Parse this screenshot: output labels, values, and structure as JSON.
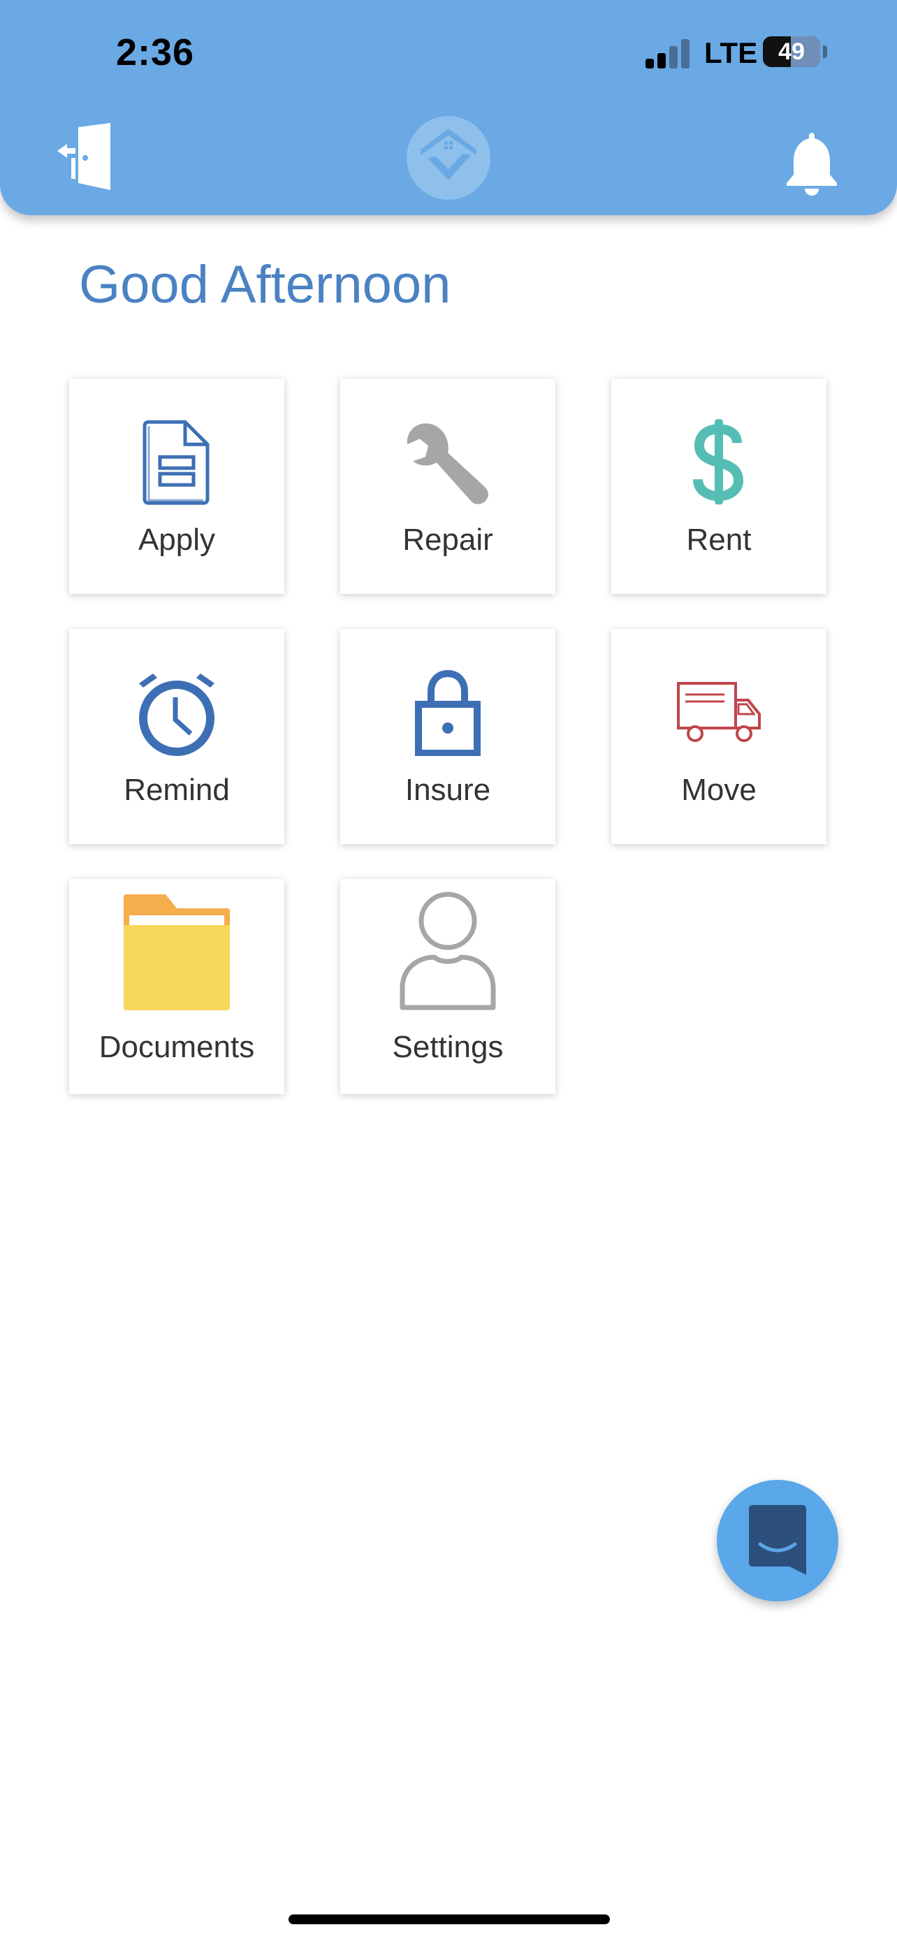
{
  "status_bar": {
    "time": "2:36",
    "network": "LTE",
    "battery_percent": "49",
    "battery_level": 0.49
  },
  "header": {
    "background_color": "#6aa9e4",
    "left_icon": "logout-door-icon",
    "center_icon": "home-logo-icon",
    "right_icon": "bell-icon"
  },
  "greeting": "Good Afternoon",
  "tiles": [
    {
      "label": "Apply",
      "icon": "document-icon",
      "color": "#3d6fb4"
    },
    {
      "label": "Repair",
      "icon": "wrench-icon",
      "color": "#a6a6a6"
    },
    {
      "label": "Rent",
      "icon": "dollar-icon",
      "color": "#56bdb4"
    },
    {
      "label": "Remind",
      "icon": "alarm-clock-icon",
      "color": "#3d6fb4"
    },
    {
      "label": "Insure",
      "icon": "lock-icon",
      "color": "#3d6fb4"
    },
    {
      "label": "Move",
      "icon": "truck-icon",
      "color": "#c0464c"
    },
    {
      "label": "Documents",
      "icon": "folder-icon",
      "color": "#f7d759"
    },
    {
      "label": "Settings",
      "icon": "user-icon",
      "color": "#a6a6a6"
    }
  ],
  "chat": {
    "icon": "chat-bubble-icon",
    "color": "#5aa7e9"
  }
}
